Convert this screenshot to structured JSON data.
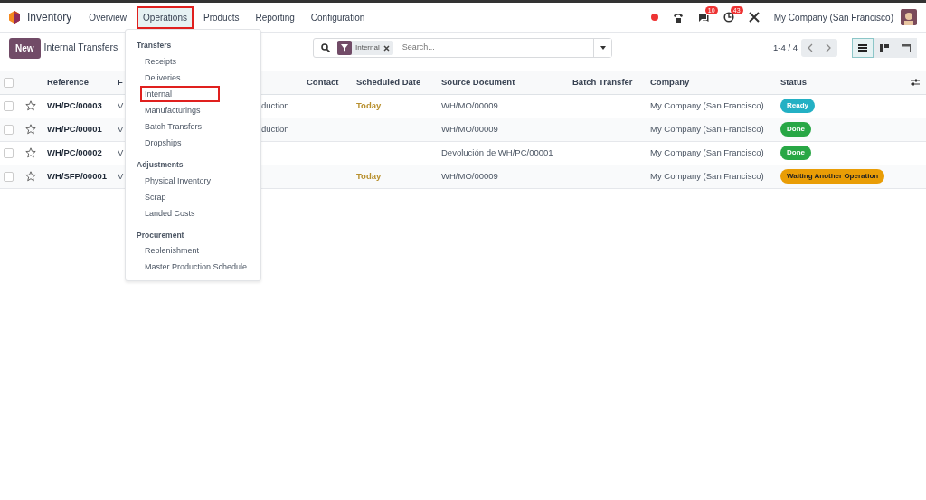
{
  "app": {
    "name": "Inventory"
  },
  "menu": [
    {
      "label": "Overview",
      "open": false,
      "annotated": false
    },
    {
      "label": "Operations",
      "open": true,
      "annotated": true
    },
    {
      "label": "Products",
      "open": false,
      "annotated": false
    },
    {
      "label": "Reporting",
      "open": false,
      "annotated": false
    },
    {
      "label": "Configuration",
      "open": false,
      "annotated": false
    }
  ],
  "systray": {
    "chat_count": "10",
    "activity_count": "43",
    "company": "My Company (San Francisco)"
  },
  "dropdown": [
    {
      "heading": "Transfers",
      "items": [
        {
          "label": "Receipts",
          "annotated": false
        },
        {
          "label": "Deliveries",
          "annotated": false
        },
        {
          "label": "Internal",
          "annotated": true
        },
        {
          "label": "Manufacturings",
          "annotated": false
        },
        {
          "label": "Batch Transfers",
          "annotated": false
        },
        {
          "label": "Dropships",
          "annotated": false
        }
      ]
    },
    {
      "heading": "Adjustments",
      "items": [
        {
          "label": "Physical Inventory",
          "annotated": false
        },
        {
          "label": "Scrap",
          "annotated": false
        },
        {
          "label": "Landed Costs",
          "annotated": false
        }
      ]
    },
    {
      "heading": "Procurement",
      "items": [
        {
          "label": "Replenishment",
          "annotated": false
        },
        {
          "label": "Master Production Schedule",
          "annotated": false
        }
      ]
    }
  ],
  "control_panel": {
    "new_button": "New",
    "title": "Internal Transfers",
    "facet": "Internal",
    "search_placeholder": "Search...",
    "pager": "1-4 / 4",
    "views": [
      {
        "kind": "list",
        "selected": true
      },
      {
        "kind": "kanban",
        "selected": false
      },
      {
        "kind": "calendar",
        "selected": false
      }
    ]
  },
  "table": {
    "select_all_checked": false,
    "columns": [
      "Reference",
      "F",
      "",
      "Contact",
      "Scheduled Date",
      "Source Document",
      "Batch Transfer",
      "Company",
      "Status"
    ],
    "rows": [
      {
        "reference": "WH/PC/00003",
        "column_2": "V",
        "column_3": "duction",
        "contact": "",
        "scheduled": "Today",
        "source": "WH/MO/00009",
        "batch": "",
        "company": "My Company (San Francisco)",
        "status": "Ready",
        "color": "#23b0c4",
        "checked": false
      },
      {
        "reference": "WH/PC/00001",
        "column_2": "V",
        "column_3": "duction",
        "contact": "",
        "scheduled": "",
        "source": "WH/MO/00009",
        "batch": "",
        "company": "My Company (San Francisco)",
        "status": "Done",
        "color": "#28a745",
        "checked": false
      },
      {
        "reference": "WH/PC/00002",
        "column_2": "V",
        "column_3": "",
        "contact": "",
        "scheduled": "",
        "source": "Devolución de WH/PC/00001",
        "batch": "",
        "company": "My Company (San Francisco)",
        "status": "Done",
        "color": "#28a745",
        "checked": false
      },
      {
        "reference": "WH/SFP/00001",
        "column_2": "V",
        "column_3": "",
        "contact": "",
        "scheduled": "Today",
        "source": "WH/MO/00009",
        "batch": "",
        "company": "My Company (San Francisco)",
        "status": "Waiting Another Operation",
        "color": "#e99d06",
        "checked": false
      }
    ]
  }
}
